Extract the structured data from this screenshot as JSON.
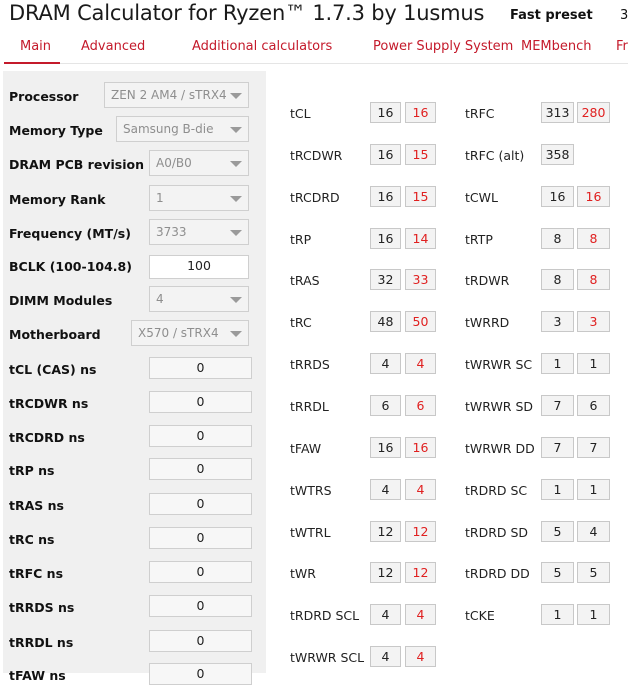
{
  "app": {
    "title": "DRAM Calculator for Ryzen™ 1.7.3 by 1usmus"
  },
  "preset": {
    "label": "Fast preset",
    "value": "3"
  },
  "tabs": [
    {
      "label": "Main"
    },
    {
      "label": "Advanced"
    },
    {
      "label": "Additional calculators"
    },
    {
      "label": "Power Supply System"
    },
    {
      "label": "MEMbench"
    },
    {
      "label": "Fr"
    }
  ],
  "settings": [
    {
      "label": "Processor",
      "value": "ZEN 2 AM4 / sTRX4"
    },
    {
      "label": "Memory Type",
      "value": "Samsung B-die"
    },
    {
      "label": "DRAM PCB revision",
      "value": "A0/B0"
    },
    {
      "label": "Memory Rank",
      "value": "1"
    },
    {
      "label": "Frequency (MT/s)",
      "value": "3733"
    },
    {
      "label": "BCLK (100-104.8)",
      "value": "100"
    },
    {
      "label": "DIMM Modules",
      "value": "4"
    },
    {
      "label": "Motherboard",
      "value": "X570 / sTRX4"
    }
  ],
  "ns_fields": [
    {
      "label": "tCL (CAS) ns",
      "value": "0"
    },
    {
      "label": "tRCDWR ns",
      "value": "0"
    },
    {
      "label": "tRCDRD ns",
      "value": "0"
    },
    {
      "label": "tRP ns",
      "value": "0"
    },
    {
      "label": "tRAS ns",
      "value": "0"
    },
    {
      "label": "tRC ns",
      "value": "0"
    },
    {
      "label": "tRFC ns",
      "value": "0"
    },
    {
      "label": "tRRDS ns",
      "value": "0"
    },
    {
      "label": "tRRDL ns",
      "value": "0"
    },
    {
      "label": "tFAW ns",
      "value": "0"
    }
  ],
  "timings_left": [
    {
      "name": "tCL",
      "v1": "16",
      "v2": "16",
      "v2_red": true
    },
    {
      "name": "tRCDWR",
      "v1": "16",
      "v2": "15",
      "v2_red": true
    },
    {
      "name": "tRCDRD",
      "v1": "16",
      "v2": "15",
      "v2_red": true
    },
    {
      "name": "tRP",
      "v1": "16",
      "v2": "14",
      "v2_red": true
    },
    {
      "name": "tRAS",
      "v1": "32",
      "v2": "33",
      "v2_red": true
    },
    {
      "name": "tRC",
      "v1": "48",
      "v2": "50",
      "v2_red": true
    },
    {
      "name": "tRRDS",
      "v1": "4",
      "v2": "4",
      "v2_red": true
    },
    {
      "name": "tRRDL",
      "v1": "6",
      "v2": "6",
      "v2_red": true
    },
    {
      "name": "tFAW",
      "v1": "16",
      "v2": "16",
      "v2_red": true
    },
    {
      "name": "tWTRS",
      "v1": "4",
      "v2": "4",
      "v2_red": true
    },
    {
      "name": "tWTRL",
      "v1": "12",
      "v2": "12",
      "v2_red": true
    },
    {
      "name": "tWR",
      "v1": "12",
      "v2": "12",
      "v2_red": true
    },
    {
      "name": "tRDRD SCL",
      "v1": "4",
      "v2": "4",
      "v2_red": true
    },
    {
      "name": "tWRWR SCL",
      "v1": "4",
      "v2": "4",
      "v2_red": true
    }
  ],
  "timings_right": [
    {
      "name": "tRFC",
      "v1": "313",
      "v2": "280",
      "v2_red": true
    },
    {
      "name": "tRFC (alt)",
      "v1": "358",
      "v2": null,
      "v2_red": false
    },
    {
      "name": "tCWL",
      "v1": "16",
      "v2": "16",
      "v2_red": true
    },
    {
      "name": "tRTP",
      "v1": "8",
      "v2": "8",
      "v2_red": true
    },
    {
      "name": "tRDWR",
      "v1": "8",
      "v2": "8",
      "v2_red": true
    },
    {
      "name": "tWRRD",
      "v1": "3",
      "v2": "3",
      "v2_red": true
    },
    {
      "name": "tWRWR SC",
      "v1": "1",
      "v2": "1",
      "v2_red": false
    },
    {
      "name": "tWRWR SD",
      "v1": "7",
      "v2": "6",
      "v2_red": false
    },
    {
      "name": "tWRWR DD",
      "v1": "7",
      "v2": "7",
      "v2_red": false
    },
    {
      "name": "tRDRD SC",
      "v1": "1",
      "v2": "1",
      "v2_red": false
    },
    {
      "name": "tRDRD SD",
      "v1": "5",
      "v2": "4",
      "v2_red": false
    },
    {
      "name": "tRDRD DD",
      "v1": "5",
      "v2": "5",
      "v2_red": false
    },
    {
      "name": "tCKE",
      "v1": "1",
      "v2": "1",
      "v2_red": false
    }
  ],
  "colors": {
    "accent": "#c41a2b",
    "highlight_value": "#e02020",
    "panel_bg": "#f0f0f0"
  }
}
